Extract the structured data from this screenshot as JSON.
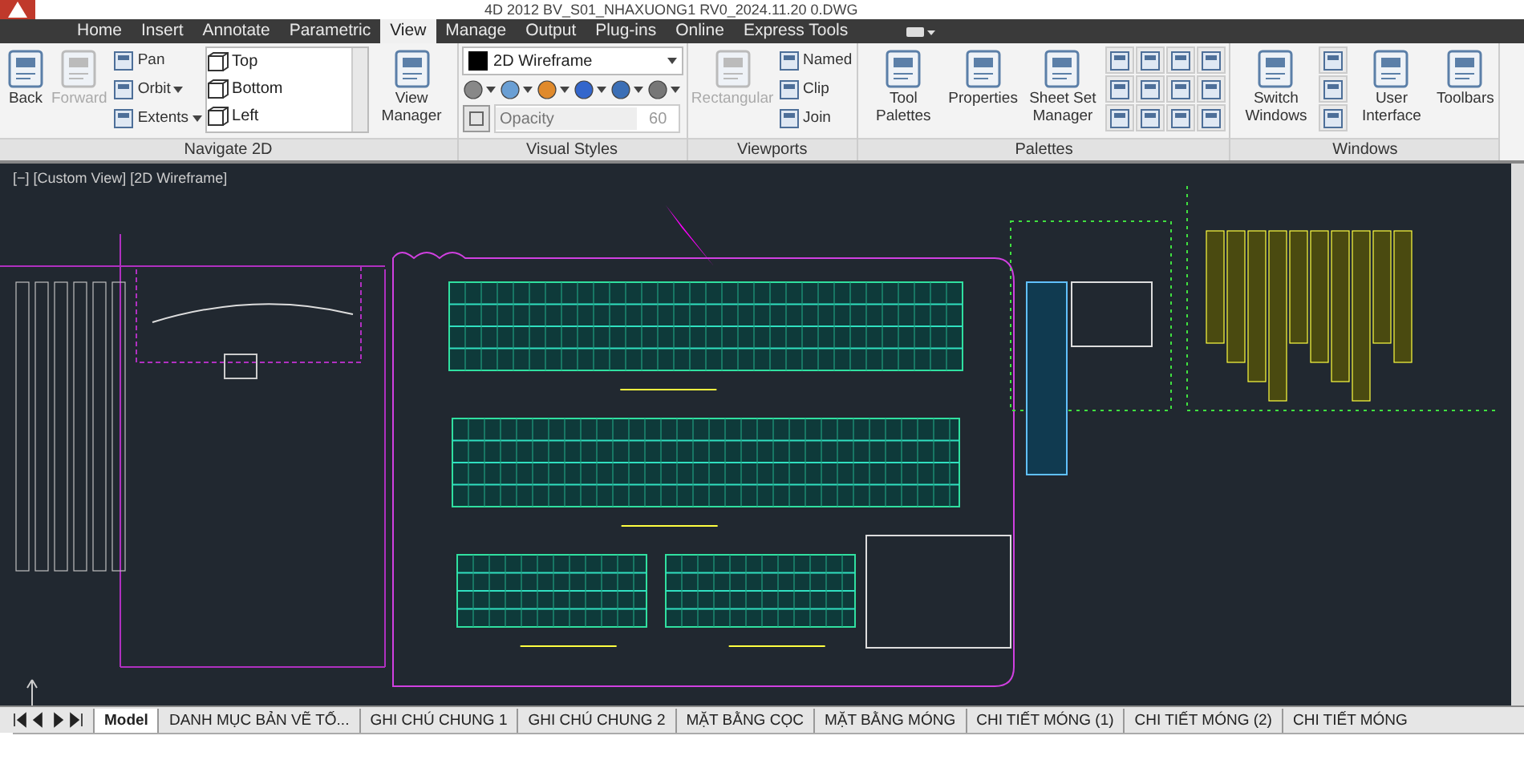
{
  "window": {
    "title": "4D 2012    BV_S01_NHAXUONG1 RV0_2024.11.20 0.DWG"
  },
  "ribbon_tabs": [
    {
      "label": "Home",
      "selected": false
    },
    {
      "label": "Insert",
      "selected": false
    },
    {
      "label": "Annotate",
      "selected": false
    },
    {
      "label": "Parametric",
      "selected": false
    },
    {
      "label": "View",
      "selected": true
    },
    {
      "label": "Manage",
      "selected": false
    },
    {
      "label": "Output",
      "selected": false
    },
    {
      "label": "Plug-ins",
      "selected": false
    },
    {
      "label": "Online",
      "selected": false
    },
    {
      "label": "Express Tools",
      "selected": false
    }
  ],
  "panels": [
    {
      "label": "Navigate 2D",
      "groups": [
        {
          "kind": "large",
          "label": "Back",
          "disabled": false
        },
        {
          "kind": "large",
          "label": "Forward",
          "disabled": true
        },
        {
          "kind": "small",
          "items": [
            {
              "label": "Pan",
              "caret": false
            },
            {
              "label": "Orbit",
              "caret": true
            },
            {
              "label": "Extents",
              "caret": true
            }
          ]
        },
        {
          "kind": "list",
          "items": [
            "Top",
            "Bottom",
            "Left"
          ]
        },
        {
          "kind": "large",
          "label": "View Manager",
          "disabled": false
        }
      ]
    },
    {
      "label": "Visual Styles",
      "groups": [
        {
          "kind": "styles",
          "dropdown": "2D Wireframe",
          "field_placeholder": "Opacity",
          "field_value": "60"
        }
      ]
    },
    {
      "label": "Viewports",
      "groups": [
        {
          "kind": "large",
          "label": "Rectangular",
          "disabled": true
        },
        {
          "kind": "small",
          "items": [
            {
              "label": "Named",
              "caret": false
            },
            {
              "label": "Clip",
              "caret": false
            },
            {
              "label": "Join",
              "caret": false
            }
          ]
        }
      ]
    },
    {
      "label": "Palettes",
      "groups": [
        {
          "kind": "large",
          "label": "Tool Palettes",
          "disabled": false
        },
        {
          "kind": "large",
          "label": "Properties",
          "disabled": false
        },
        {
          "kind": "large",
          "label": "Sheet Set Manager",
          "disabled": false
        },
        {
          "kind": "grid"
        },
        {
          "kind": "grid"
        }
      ]
    },
    {
      "label": "Windows",
      "groups": [
        {
          "kind": "large",
          "label": "Switch Windows",
          "disabled": false
        },
        {
          "kind": "grid1"
        },
        {
          "kind": "large",
          "label": "User Interface",
          "disabled": false
        },
        {
          "kind": "large",
          "label": "Toolbars",
          "disabled": false
        }
      ]
    }
  ],
  "viewport": {
    "label": "[−] [Custom View] [2D Wireframe]"
  },
  "layout_tabs": [
    {
      "label": "Model",
      "selected": true
    },
    {
      "label": "DANH MỤC BẢN VẼ TỐ...",
      "selected": false
    },
    {
      "label": "GHI CHÚ CHUNG 1",
      "selected": false
    },
    {
      "label": "GHI CHÚ CHUNG 2",
      "selected": false
    },
    {
      "label": "MẶT BẰNG CỌC",
      "selected": false
    },
    {
      "label": "MẶT BẰNG MÓNG",
      "selected": false
    },
    {
      "label": "CHI TIẾT MÓNG (1)",
      "selected": false
    },
    {
      "label": "CHI TIẾT MÓNG (2)",
      "selected": false
    },
    {
      "label": "CHI TIẾT MÓNG",
      "selected": false
    }
  ]
}
